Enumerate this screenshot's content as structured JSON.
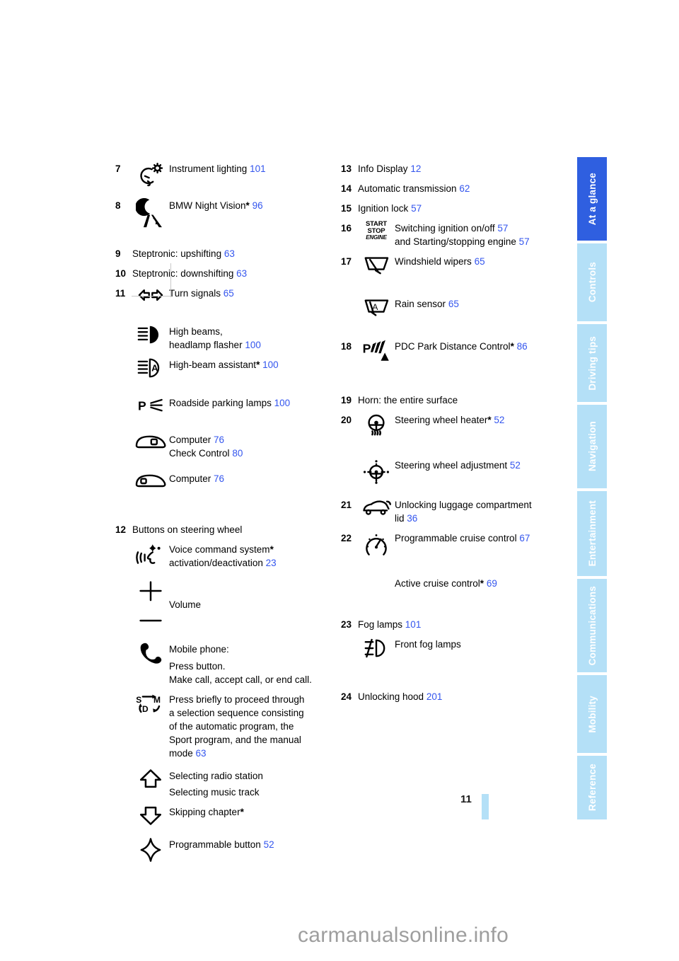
{
  "document": {
    "page_number": "11",
    "watermark": "carmanualsonline.info"
  },
  "sidebar": {
    "tabs": [
      {
        "label": "At a glance",
        "active": true
      },
      {
        "label": "Controls",
        "active": false
      },
      {
        "label": "Driving tips",
        "active": false
      },
      {
        "label": "Navigation",
        "active": false
      },
      {
        "label": "Entertainment",
        "active": false
      },
      {
        "label": "Communications",
        "active": false
      },
      {
        "label": "Mobility",
        "active": false
      },
      {
        "label": "Reference",
        "active": false
      }
    ],
    "active_color": "#2f5fe0",
    "inactive_color": "#b4e0f7"
  },
  "colors": {
    "page_ref": "#3355ee",
    "text": "#000000",
    "watermark": "#9e9e9e"
  },
  "left_column": [
    {
      "number": "7",
      "icon": "instrument-lighting-icon",
      "lines": [
        {
          "text": "Instrument lighting",
          "page": "101"
        }
      ]
    },
    {
      "number": "8",
      "icon": "night-vision-icon",
      "lines": [
        {
          "text": "BMW Night Vision",
          "star": true,
          "page": "96"
        }
      ]
    },
    {
      "number": "9",
      "icon": null,
      "lines": [
        {
          "text": "Steptronic: upshifting",
          "page": "63"
        }
      ]
    },
    {
      "number": "10",
      "icon": null,
      "lines": [
        {
          "text": "Steptronic: downshifting",
          "page": "63"
        }
      ]
    },
    {
      "number": "11",
      "icon": "turn-signals-icon",
      "lines": [
        {
          "text": "Turn signals",
          "page": "65"
        }
      ]
    },
    {
      "number": "",
      "icon": "high-beams-icon",
      "lines": [
        {
          "text": "High beams,"
        },
        {
          "text": "headlamp flasher",
          "page": "100"
        }
      ]
    },
    {
      "number": "",
      "icon": "high-beam-assistant-icon",
      "lines": [
        {
          "text": "High-beam assistant",
          "star": true,
          "page": "100"
        }
      ]
    },
    {
      "number": "",
      "icon": "roadside-parking-lamps-icon",
      "lines": [
        {
          "text": "Roadside parking lamps",
          "page": "100"
        }
      ]
    },
    {
      "number": "",
      "icon": "stalk-button-computer-icon",
      "lines": [
        {
          "text": "Computer",
          "page": "76"
        },
        {
          "text": "Check Control",
          "page": "80"
        }
      ]
    },
    {
      "number": "",
      "icon": "stalk-button-computer2-icon",
      "lines": [
        {
          "text": "Computer",
          "page": "76"
        }
      ]
    },
    {
      "number": "12",
      "icon": null,
      "lines": [
        {
          "text": "Buttons on steering wheel"
        }
      ]
    },
    {
      "number": "",
      "icon": "voice-command-icon",
      "lines": [
        {
          "text": "Voice command system",
          "star": true
        },
        {
          "text": "activation/deactivation",
          "page": "23"
        }
      ]
    },
    {
      "number": "",
      "icon": "volume-plus-minus-icon",
      "lines": [
        {
          "text": "Volume"
        }
      ]
    },
    {
      "number": "",
      "icon": "mobile-phone-icon",
      "lines": [
        {
          "text": "Mobile phone:"
        },
        {
          "text": "Press button."
        },
        {
          "text": "Make call, accept call, or end call."
        }
      ]
    },
    {
      "number": "",
      "icon": "shift-program-sdm-icon",
      "lines": [
        {
          "text": "Press briefly to proceed through"
        },
        {
          "text": "a selection sequence consisting"
        },
        {
          "text": "of the automatic program, the"
        },
        {
          "text": "Sport program, and the manual"
        },
        {
          "text": "mode",
          "page": "63"
        }
      ]
    },
    {
      "number": "",
      "icon": "arrow-up-icon",
      "lines": [
        {
          "text": "Selecting radio station"
        },
        {
          "text": "Selecting music track"
        }
      ]
    },
    {
      "number": "",
      "icon": "arrow-down-icon",
      "lines": [
        {
          "text": "Skipping chapter",
          "star": true
        }
      ]
    },
    {
      "number": "",
      "icon": "programmable-button-icon",
      "lines": [
        {
          "text": "Programmable button",
          "page": "52"
        }
      ]
    }
  ],
  "right_column": [
    {
      "number": "13",
      "icon": null,
      "lines": [
        {
          "text": "Info Display",
          "page": "12"
        }
      ]
    },
    {
      "number": "14",
      "icon": null,
      "lines": [
        {
          "text": "Automatic transmission",
          "page": "62"
        }
      ]
    },
    {
      "number": "15",
      "icon": null,
      "lines": [
        {
          "text": "Ignition lock",
          "page": "57"
        }
      ]
    },
    {
      "number": "16",
      "icon": "start-stop-engine-icon",
      "lines": [
        {
          "text": "Switching ignition on/off",
          "page": "57"
        },
        {
          "text": "and Starting/stopping engine",
          "page": "57"
        }
      ]
    },
    {
      "number": "17",
      "icon": "windshield-wipers-icon",
      "lines": [
        {
          "text": "Windshield wipers",
          "page": "65"
        }
      ]
    },
    {
      "number": "",
      "icon": "rain-sensor-icon",
      "lines": [
        {
          "text": "Rain sensor",
          "page": "65"
        }
      ]
    },
    {
      "number": "18",
      "icon": "pdc-icon",
      "lines": [
        {
          "text": "PDC Park Distance Control",
          "star": true,
          "page": "86"
        }
      ]
    },
    {
      "number": "19",
      "icon": null,
      "lines": [
        {
          "text": "Horn: the entire surface"
        }
      ]
    },
    {
      "number": "20",
      "icon": "steering-wheel-heater-icon",
      "lines": [
        {
          "text": "Steering wheel heater",
          "star": true,
          "page": "52"
        }
      ]
    },
    {
      "number": "",
      "icon": "steering-wheel-adjustment-icon",
      "lines": [
        {
          "text": "Steering wheel adjustment",
          "page": "52"
        }
      ]
    },
    {
      "number": "21",
      "icon": "luggage-compartment-icon",
      "lines": [
        {
          "text": "Unlocking luggage compartment"
        },
        {
          "text": "lid",
          "page": "36"
        }
      ]
    },
    {
      "number": "22",
      "icon": "cruise-control-icon",
      "lines": [
        {
          "text": "Programmable cruise control",
          "page": "67"
        }
      ]
    },
    {
      "number": "",
      "icon": null,
      "lines": [
        {
          "text": "Active cruise control",
          "star": true,
          "page": "69"
        }
      ]
    },
    {
      "number": "23",
      "icon": null,
      "lines": [
        {
          "text": "Fog lamps",
          "page": "101"
        }
      ]
    },
    {
      "number": "",
      "icon": "front-fog-lamps-icon",
      "lines": [
        {
          "text": "Front fog lamps"
        }
      ]
    },
    {
      "number": "24",
      "icon": null,
      "lines": [
        {
          "text": "Unlocking hood",
          "page": "201"
        }
      ]
    }
  ]
}
